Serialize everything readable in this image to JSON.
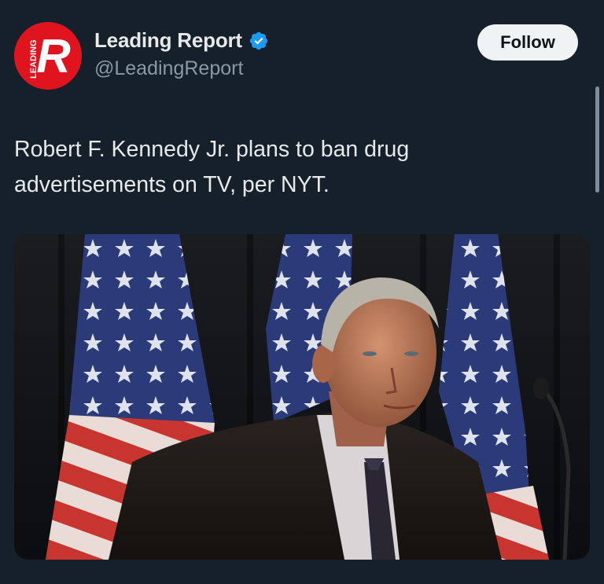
{
  "account": {
    "display_name": "Leading Report",
    "handle": "@LeadingReport",
    "verified": true,
    "verified_icon": "verified-badge-icon",
    "avatar_letter": "R",
    "avatar_side_text": "LEADING",
    "avatar_color": "#e0141e"
  },
  "follow_button": {
    "label": "Follow"
  },
  "tweet": {
    "text": "Robert F. Kennedy Jr. plans to ban drug advertisements on TV, per NYT."
  },
  "media": {
    "image_icon": "photo-image"
  },
  "colors": {
    "background": "#15202b",
    "primary_text": "#e7e9ea",
    "secondary_text": "#8b98a5",
    "verified_blue": "#1d9bf0",
    "button_bg": "#eff3f4"
  }
}
